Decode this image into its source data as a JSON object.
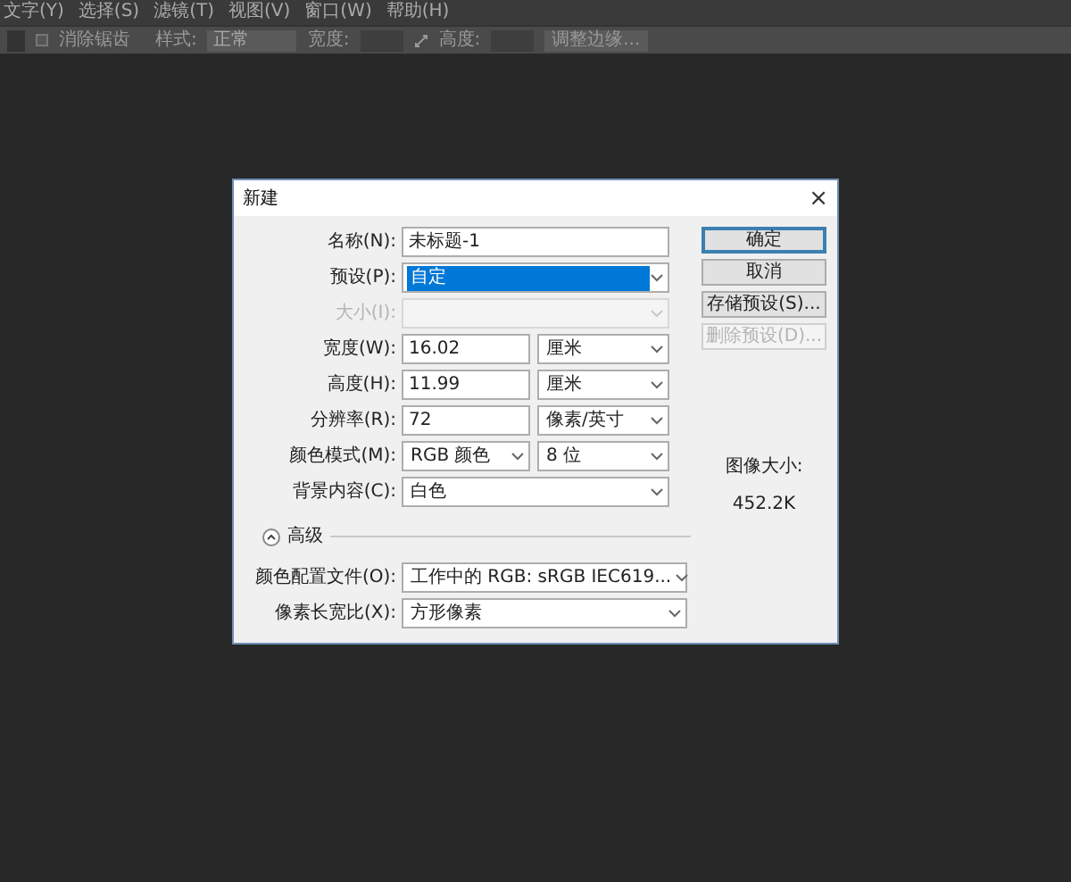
{
  "menu_bar": [
    "文字(Y)",
    "选择(S)",
    "滤镜(T)",
    "视图(V)",
    "窗口(W)",
    "帮助(H)"
  ],
  "options_bar": {
    "anti_alias": {
      "label": "消除锯齿",
      "checked": false
    },
    "style_label": "样式:",
    "style_value": "正常",
    "width_label": "宽度:",
    "height_label": "高度:",
    "refine_button": "调整边缘..."
  },
  "dialog": {
    "title": "新建",
    "close": "×",
    "name_field": {
      "label": "名称(N):",
      "value": "未标题-1"
    },
    "preset": {
      "label": "预设(P):",
      "value": "自定",
      "selected": true
    },
    "size": {
      "label": "大小(I):",
      "disabled": true
    },
    "rows": [
      {
        "kind": "value_unit",
        "label": "宽度(W):",
        "value": "16.02",
        "unit": "厘米"
      },
      {
        "kind": "value_unit",
        "label": "高度(H):",
        "value": "11.99",
        "unit": "厘米"
      },
      {
        "kind": "value_unit",
        "label": "分辨率(R):",
        "value": "72",
        "unit": "像素/英寸"
      },
      {
        "kind": "two_selects",
        "label": "颜色模式(M):",
        "value": "RGB 颜色",
        "unit": "8 位"
      },
      {
        "kind": "select",
        "label": "背景内容(C):",
        "value": "白色"
      }
    ],
    "advanced": {
      "label": "高级",
      "expanded": true,
      "rows": [
        {
          "label": "颜色配置文件(O):",
          "value": "工作中的 RGB: sRGB IEC619..."
        },
        {
          "label": "像素长宽比(X):",
          "value": "方形像素"
        }
      ]
    },
    "buttons": [
      {
        "label": "确定",
        "default": true,
        "disabled": false
      },
      {
        "label": "取消",
        "default": false,
        "disabled": false
      },
      {
        "label": "存储预设(S)...",
        "default": false,
        "disabled": false
      },
      {
        "label": "删除预设(D)...",
        "default": false,
        "disabled": true
      }
    ],
    "image_size": {
      "label": "图像大小:",
      "value": "452.2K"
    }
  }
}
